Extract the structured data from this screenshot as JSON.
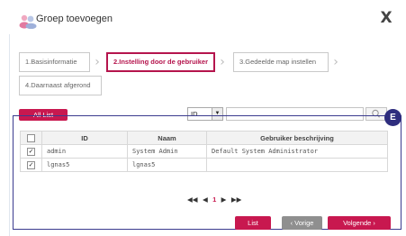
{
  "dialog": {
    "title": "Groep toevoegen",
    "close_label": "X",
    "badge": "E"
  },
  "steps": [
    {
      "label": "1.Basisinformatie",
      "active": false
    },
    {
      "label": "2.Instelling door de gebruiker",
      "active": true
    },
    {
      "label": "3.Gedeelde map instellen",
      "active": false
    },
    {
      "label": "4.Daarnaast afgerond",
      "active": false
    }
  ],
  "toolbar": {
    "all_list_label": "All List",
    "search_field_value": "ID",
    "search_query": ""
  },
  "table": {
    "columns": [
      "ID",
      "Naam",
      "Gebruiker beschrijving"
    ],
    "rows": [
      {
        "checked": true,
        "id": "admin",
        "name": "System Admin",
        "description": "Default System Administrator"
      },
      {
        "checked": true,
        "id": "lgnas5",
        "name": "lgnas5",
        "description": ""
      }
    ]
  },
  "pager": {
    "first": "◀◀",
    "prev": "◀",
    "current_page": "1",
    "next": "▶",
    "last": "▶▶"
  },
  "footer": {
    "list_label": "List",
    "prev_label": "‹ Vorige",
    "next_label": "Volgende ›"
  },
  "colors": {
    "accent": "#c8184f",
    "highlight": "#2e2d7e"
  }
}
